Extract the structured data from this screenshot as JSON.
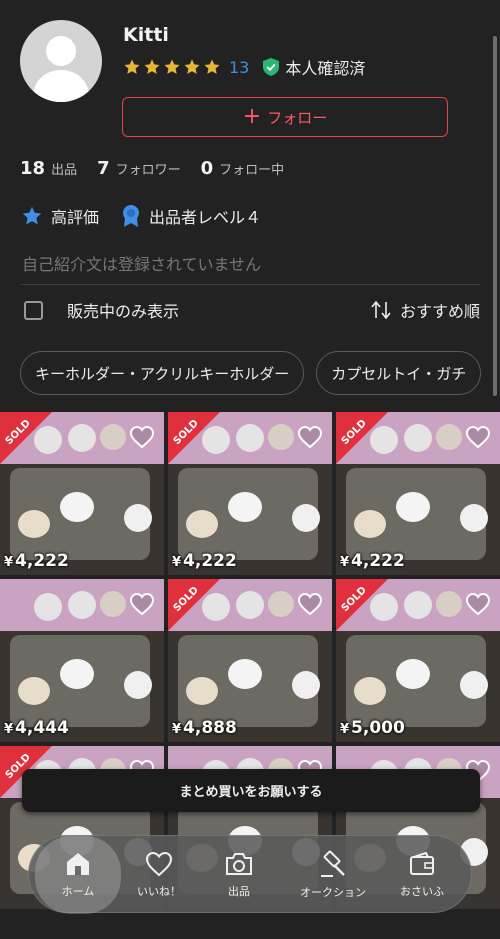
{
  "profile": {
    "username": "Kitti",
    "rating_count": "13",
    "stars": 5,
    "verified_label": "本人確認済",
    "follow_label": "フォロー",
    "stats": [
      {
        "num": "18",
        "label": "出品"
      },
      {
        "num": "7",
        "label": "フォロワー"
      },
      {
        "num": "0",
        "label": "フォロー中"
      }
    ],
    "badges": [
      {
        "label": "高評価"
      },
      {
        "label": "出品者レベル４"
      }
    ],
    "bio": "自己紹介文は登録されていません"
  },
  "filter": {
    "on_sale_only_label": "販売中のみ表示",
    "sort_label": "おすすめ順"
  },
  "chips": [
    "キーホルダー・アクリルキーホルダー",
    "カプセルトイ・ガチ"
  ],
  "items": [
    {
      "price": "4,222",
      "sold": true,
      "sold_label": "SOLD"
    },
    {
      "price": "4,222",
      "sold": true,
      "sold_label": "SOLD"
    },
    {
      "price": "4,222",
      "sold": true,
      "sold_label": "SOLD"
    },
    {
      "price": "4,444",
      "sold": false
    },
    {
      "price": "4,888",
      "sold": true,
      "sold_label": "SOLD"
    },
    {
      "price": "5,000",
      "sold": true,
      "sold_label": "SOLD"
    },
    {
      "price": "",
      "sold": true,
      "sold_label": "SOLD"
    },
    {
      "price": "",
      "sold": false
    },
    {
      "price": "",
      "sold": false
    }
  ],
  "currency": "¥",
  "bulk_request_label": "まとめ買いをお願いする",
  "tabs": [
    {
      "label": "ホーム",
      "icon": "home-icon",
      "active": true
    },
    {
      "label": "いいね！",
      "icon": "heart-icon"
    },
    {
      "label": "出品",
      "icon": "camera-icon"
    },
    {
      "label": "オークション",
      "icon": "gavel-icon"
    },
    {
      "label": "おさいふ",
      "icon": "wallet-icon"
    }
  ],
  "colors": {
    "background": "#222222",
    "accent_red": "#e5414f",
    "link_blue": "#3f8fe6",
    "star_gold": "#e8b437",
    "verified_green": "#2bb673"
  }
}
